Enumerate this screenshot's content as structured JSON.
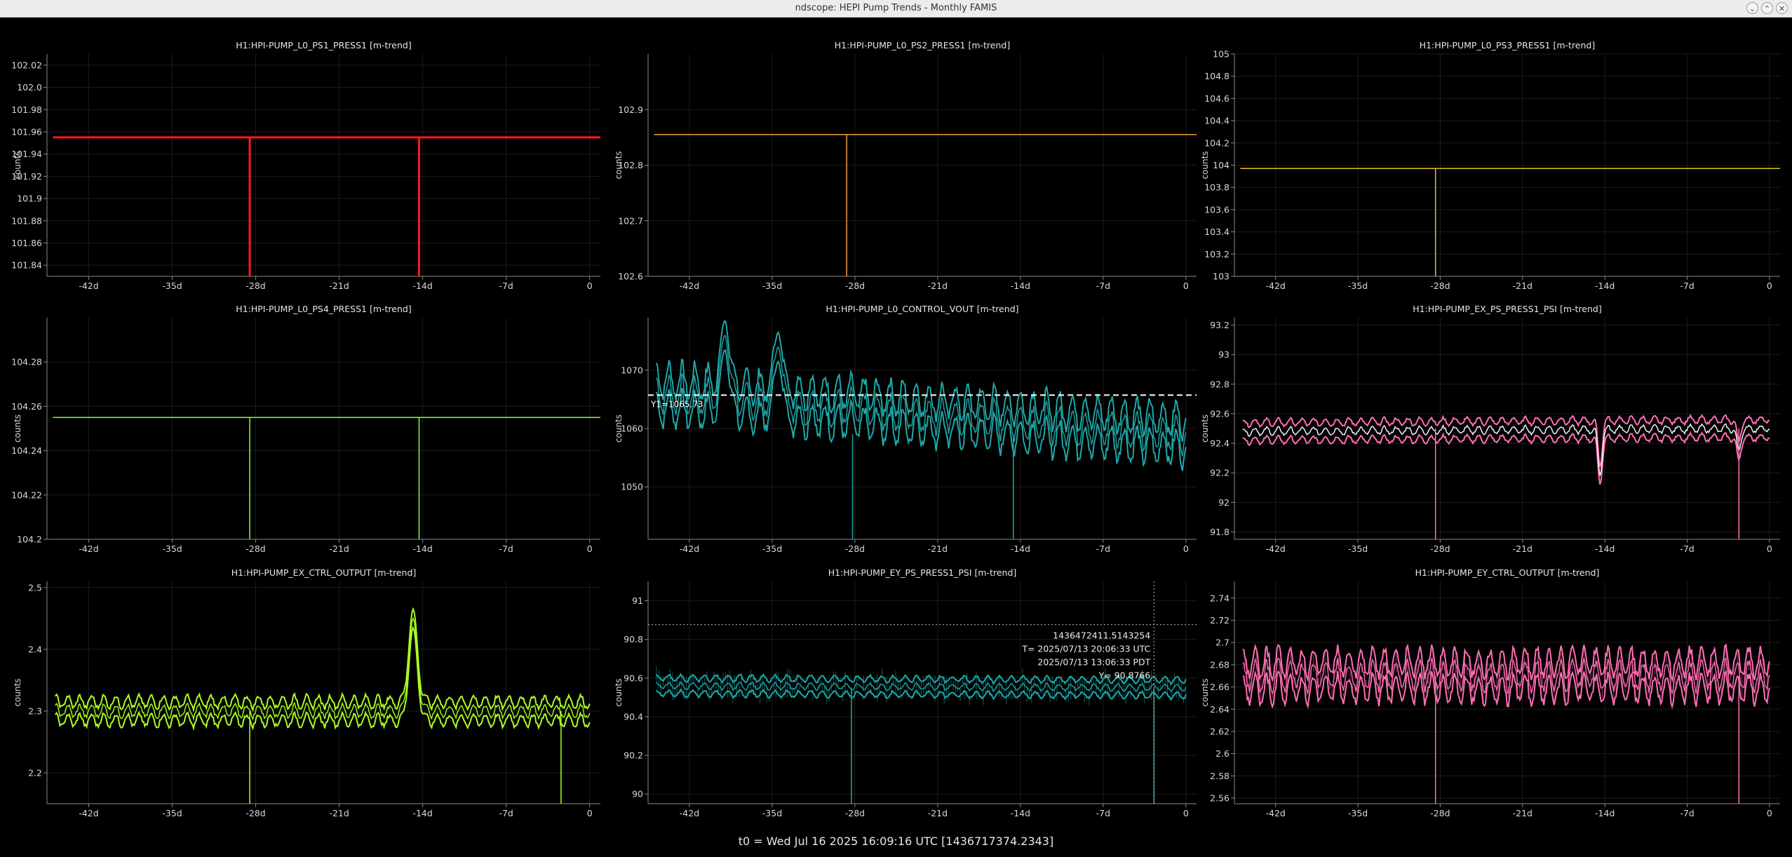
{
  "window": {
    "title": "ndscope: HEPI Pump Trends - Monthly FAMIS",
    "buttons": [
      {
        "name": "minimize-button",
        "glyph": "⌄"
      },
      {
        "name": "maximize-button",
        "glyph": "⌃"
      },
      {
        "name": "close-button",
        "glyph": "✕"
      }
    ]
  },
  "status": {
    "t0_label": "t0 = Wed Jul 16 2025 16:09:16 UTC [1436717374.2343]"
  },
  "x_axis": {
    "ticks": [
      "-42d",
      "-35d",
      "-28d",
      "-21d",
      "-14d",
      "-7d",
      "0"
    ],
    "ylabel": "counts"
  },
  "plots": [
    {
      "title": "H1:HPI-PUMP_L0_PS1_PRESS1 [m-trend]",
      "color": "#ff1a1a",
      "yticks": [
        "102.02",
        "102.0",
        "101.98",
        "101.96",
        "101.94",
        "101.92",
        "101.9",
        "101.88",
        "101.86",
        "101.84"
      ],
      "ylim": [
        101.83,
        102.03
      ],
      "chart_data": {
        "type": "line",
        "trace": "flat",
        "level": 101.955,
        "spikes_at_days": [
          -28.5,
          -14.3
        ],
        "spike_to": 101.83,
        "band": 0.0,
        "noise": 0
      }
    },
    {
      "title": "H1:HPI-PUMP_L0_PS2_PRESS1 [m-trend]",
      "color": "#f0a040",
      "yticks": [
        "102.9",
        "102.8",
        "102.7",
        "102.6"
      ],
      "ylim": [
        102.6,
        103.0
      ],
      "chart_data": {
        "type": "line",
        "trace": "flat",
        "level": 102.855,
        "spikes_at_days": [
          -28.7
        ],
        "spike_to": 102.6,
        "band": 0,
        "noise": 0
      }
    },
    {
      "title": "H1:HPI-PUMP_L0_PS3_PRESS1 [m-trend]",
      "color": "#e8c020",
      "yticks": [
        "105",
        "104.8",
        "104.6",
        "104.4",
        "104.2",
        "104",
        "103.8",
        "103.6",
        "103.4",
        "103.2",
        "103"
      ],
      "ylim": [
        103.0,
        105.0
      ],
      "chart_data": {
        "type": "line",
        "trace": "flat",
        "level": 103.97,
        "spikes_at_days": [
          -28.4
        ],
        "spike_to": 103.0,
        "band": 0,
        "noise": 0
      }
    },
    {
      "title": "H1:HPI-PUMP_L0_PS4_PRESS1 [m-trend]",
      "color": "#80ff40",
      "yticks": [
        "104.28",
        "104.26",
        "104.24",
        "104.22",
        "104.2"
      ],
      "ylim": [
        104.2,
        104.3
      ],
      "chart_data": {
        "type": "line",
        "trace": "flat",
        "level": 104.255,
        "spikes_at_days": [
          -28.5,
          -14.3
        ],
        "spike_to": 104.2,
        "band": 0,
        "noise": 0
      }
    },
    {
      "title": "H1:HPI-PUMP_L0_CONTROL_VOUT [m-trend]",
      "color": "#1fa8a8",
      "yticks": [
        "1070",
        "1060",
        "1050"
      ],
      "ylim": [
        1041,
        1079
      ],
      "cursor": {
        "y": 1065.73,
        "label": "Y1=1065.73"
      },
      "chart_data": {
        "type": "line",
        "trace": "noisy",
        "level_start": 1066,
        "level_end": 1059,
        "band": 2.5,
        "noise": 3.5,
        "period_days": 1.1,
        "spikes_at_days": [
          -28.2,
          -14.6
        ],
        "spike_to": 1041,
        "bumps": [
          [
            -39,
            1076
          ],
          [
            -34.5,
            1074
          ]
        ]
      }
    },
    {
      "title": "H1:HPI-PUMP_EX_PS_PRESS1_PSI [m-trend]",
      "color": "#ff6eb4",
      "yticks": [
        "93.2",
        "93",
        "92.8",
        "92.6",
        "92.4",
        "92.2",
        "92",
        "91.8"
      ],
      "ylim": [
        91.75,
        93.25
      ],
      "chart_data": {
        "type": "line",
        "trace": "noisy",
        "level_start": 92.48,
        "level_end": 92.5,
        "band": 0.06,
        "noise": 0.03,
        "period_days": 1.0,
        "spikes_at_days": [
          -28.4,
          -2.6
        ],
        "spike_to": 91.75,
        "dips": [
          [
            -14.4,
            92.18
          ],
          [
            -2.6,
            92.35
          ]
        ]
      }
    },
    {
      "title": "H1:HPI-PUMP_EX_CTRL_OUTPUT [m-trend]",
      "color": "#aaff22",
      "yticks": [
        "2.5",
        "2.4",
        "2.3",
        "2.2"
      ],
      "ylim": [
        2.15,
        2.51
      ],
      "chart_data": {
        "type": "line",
        "trace": "noisy",
        "level_start": 2.3,
        "level_end": 2.3,
        "band": 0.015,
        "noise": 0.012,
        "period_days": 1.0,
        "spikes_at_days": [
          -28.5,
          -2.4
        ],
        "spike_to": 2.15,
        "bumps": [
          [
            -14.8,
            2.45
          ]
        ]
      }
    },
    {
      "title": "H1:HPI-PUMP_EY_PS_PRESS1_PSI [m-trend]",
      "color": "#1fa8a8",
      "yticks": [
        "91",
        "90.8",
        "90.6",
        "90.4",
        "90.2",
        "90"
      ],
      "ylim": [
        89.95,
        91.1
      ],
      "cursor_tooltip": [
        "1436472411.5143254",
        "T= 2025/07/13 20:06:33 UTC",
        "2025/07/13 13:06:33 PDT",
        "Y= 90.8766"
      ],
      "chart_data": {
        "type": "line",
        "trace": "noisy",
        "level_start": 90.56,
        "level_end": 90.55,
        "band": 0.04,
        "noise": 0.02,
        "period_days": 1.0,
        "spikes_at_days": [
          -28.3,
          -2.7
        ],
        "spike_to": 89.95,
        "fuzz": 0.12,
        "cursor_day": -2.7,
        "cursor_y": 90.8766
      }
    },
    {
      "title": "H1:HPI-PUMP_EY_CTRL_OUTPUT [m-trend]",
      "color": "#ff6eb4",
      "yticks": [
        "2.74",
        "2.72",
        "2.7",
        "2.68",
        "2.66",
        "2.64",
        "2.62",
        "2.6",
        "2.58",
        "2.56"
      ],
      "ylim": [
        2.555,
        2.755
      ],
      "chart_data": {
        "type": "line",
        "trace": "noisy",
        "level_start": 2.67,
        "level_end": 2.67,
        "band": 0.012,
        "noise": 0.015,
        "period_days": 1.0,
        "spikes_at_days": [
          -28.4,
          -2.6
        ],
        "spike_to": 2.555,
        "fuzz": 0.02
      }
    }
  ]
}
